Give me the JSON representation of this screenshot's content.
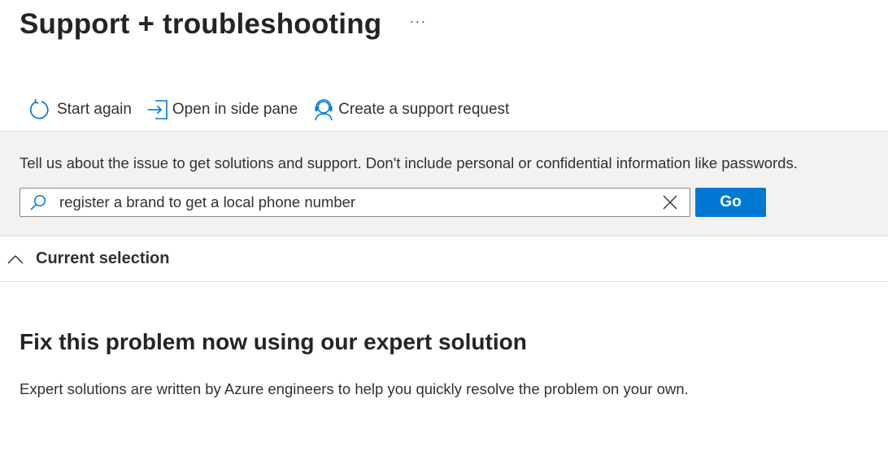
{
  "header": {
    "title": "Support + troubleshooting",
    "more_label": "···"
  },
  "toolbar": {
    "items": [
      {
        "label": "Start again",
        "icon": "refresh-icon"
      },
      {
        "label": "Open in side pane",
        "icon": "open-side-pane-icon"
      },
      {
        "label": "Create a support request",
        "icon": "support-agent-icon"
      }
    ]
  },
  "issue": {
    "prompt": "Tell us about the issue to get solutions and support. Don't include personal or confidential information like passwords.",
    "search_value": "register a brand to get a local phone number",
    "go_label": "Go"
  },
  "current_selection": {
    "label": "Current selection",
    "expanded": true
  },
  "expert": {
    "title": "Fix this problem now using our expert solution",
    "description": "Expert solutions are written by Azure engineers to help you quickly resolve the problem on your own."
  },
  "colors": {
    "accent": "#0078d4",
    "panel_bg": "#f3f2f1",
    "text": "#323130"
  }
}
